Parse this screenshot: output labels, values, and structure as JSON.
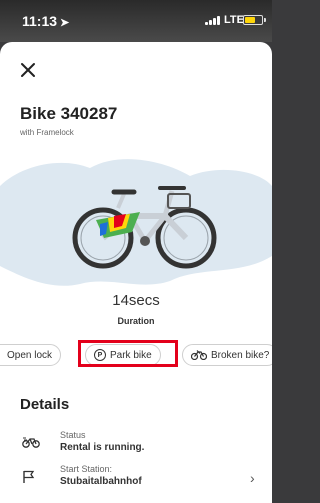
{
  "status_bar": {
    "time": "11:13",
    "location_arrow": "➤",
    "network": "LTE",
    "battery_level": 0.55,
    "battery_color": "#ffd60a"
  },
  "header": {
    "close_icon": "close-icon",
    "bike_title": "Bike 340287",
    "lock_type": "with Framelock"
  },
  "ride": {
    "duration_value": "14secs",
    "duration_label": "Duration"
  },
  "actions": {
    "open_lock": "Open lock",
    "park_icon": "P",
    "park_bike": "Park bike",
    "broken_bike": "Broken bike?",
    "highlight_color": "#e3001b"
  },
  "details": {
    "title": "Details",
    "status_label": "Status",
    "status_value": "Rental is running.",
    "start_station_label": "Start Station:",
    "start_station_value": "Stubaitalbahnhof",
    "chevron": "›"
  },
  "colors": {
    "bike_frame": "#c9cfd6",
    "hero_bg": "#dde8f1",
    "accent_red": "#e3001b"
  }
}
